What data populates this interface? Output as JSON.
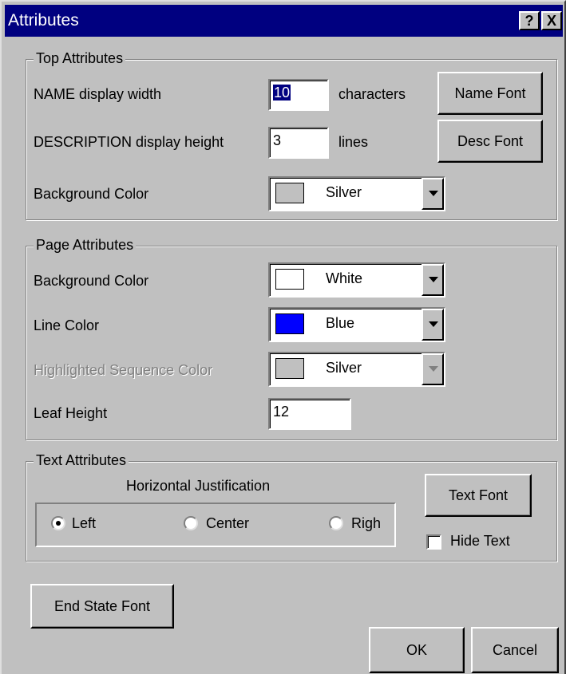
{
  "window": {
    "title": "Attributes",
    "help_icon": "?",
    "close_icon": "X",
    "title_bar_color": "#000080"
  },
  "top_attributes": {
    "legend": "Top Attributes",
    "name_width_label": "NAME display width",
    "name_width_value": "10",
    "name_width_unit": "characters",
    "name_font_button": "Name Font",
    "desc_height_label": "DESCRIPTION display height",
    "desc_height_value": "3",
    "desc_height_unit": "lines",
    "desc_font_button": "Desc Font",
    "bg_color_label": "Background Color",
    "bg_color_value": "Silver",
    "bg_color_swatch": "#c0c0c0"
  },
  "page_attributes": {
    "legend": "Page Attributes",
    "bg_color_label": "Background Color",
    "bg_color_value": "White",
    "bg_color_swatch": "#ffffff",
    "line_color_label": "Line Color",
    "line_color_value": "Blue",
    "line_color_swatch": "#0000ff",
    "highlight_label": "Highlighted Sequence Color",
    "highlight_value": "Silver",
    "highlight_swatch": "#c0c0c0",
    "leaf_height_label": "Leaf Height",
    "leaf_height_value": "12"
  },
  "text_attributes": {
    "legend": "Text Attributes",
    "justification_label": "Horizontal Justification",
    "options": [
      "Left",
      "Center",
      "Righ"
    ],
    "selected": "Left",
    "text_font_button": "Text Font",
    "hide_text_label": "Hide Text",
    "hide_text_checked": false
  },
  "buttons": {
    "end_state_font": "End State Font",
    "ok": "OK",
    "cancel": "Cancel"
  }
}
